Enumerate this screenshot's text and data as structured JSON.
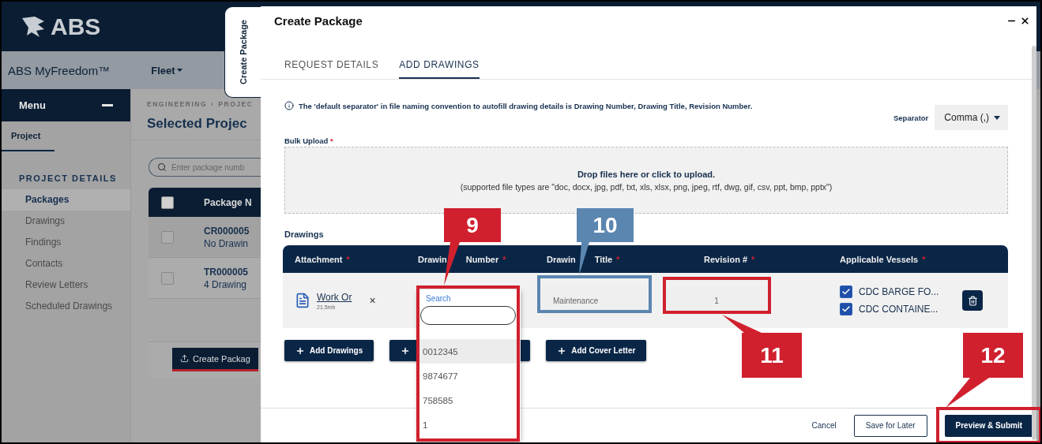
{
  "header": {
    "logo": "ABS",
    "app_name": "ABS MyFreedom™",
    "nav": [
      {
        "label": "Fleet"
      }
    ]
  },
  "sidebar": {
    "title": "Menu",
    "tabs": [
      {
        "label": "Project",
        "selected": true
      }
    ],
    "section": "PROJECT DETAILS",
    "items": [
      {
        "label": "Packages",
        "selected": true
      },
      {
        "label": "Drawings",
        "selected": false
      },
      {
        "label": "Findings",
        "selected": false
      },
      {
        "label": "Contacts",
        "selected": false
      },
      {
        "label": "Review Letters",
        "selected": false
      },
      {
        "label": "Scheduled Drawings",
        "selected": false
      }
    ]
  },
  "main": {
    "breadcrumb": {
      "items": [
        "ENGINEERING",
        "PROJEC"
      ],
      "separator": "›"
    },
    "title": "Selected Projec",
    "search": {
      "placeholder": "Enter package numb"
    },
    "table": {
      "select_all": {
        "checked": false
      },
      "columns": [
        "Package N"
      ],
      "rows": [
        {
          "selected": false,
          "title": "CR000005",
          "subtitle": "No Drawin"
        },
        {
          "selected": false,
          "title": "TR000005",
          "subtitle": "4 Drawing"
        }
      ]
    },
    "create_button": "Create Packag"
  },
  "side_tab": "Create Package",
  "drawer": {
    "title": "Create Package",
    "tabs": [
      {
        "label": "REQUEST DETAILS",
        "selected": false
      },
      {
        "label": "ADD DRAWINGS",
        "selected": true
      }
    ],
    "info": "The 'default separator' in file naming convention to autofill drawing details is Drawing Number, Drawing Title, Revision Number.",
    "separator": {
      "label": "Separator",
      "value": "Comma (,)"
    },
    "bulk_upload": {
      "label": "Bulk Upload",
      "marker": "*",
      "prompt": "Drop files here or click to upload.",
      "hint": "(supported file types are \"doc, docx, jpg, pdf, txt, xls, xlsx, png, jpeg, rtf, dwg, gif, csv, ppt, bmp, pptx\")"
    },
    "drawings": {
      "label": "Drawings",
      "columns": [
        {
          "parts": [
            "Attachment"
          ],
          "marker": "*"
        },
        {
          "parts": [
            "Drawin",
            "Number"
          ],
          "marker": "*"
        },
        {
          "parts": [
            "Drawin",
            "Title"
          ],
          "marker": "*"
        },
        {
          "parts": [
            "Revision #"
          ],
          "marker": "*"
        },
        {
          "parts": [
            "Applicable Vessels"
          ],
          "marker": "*"
        }
      ],
      "rows": [
        {
          "file": "Work Or",
          "size": "21.5mb",
          "remove": "×",
          "title": "Maintenance",
          "revision": "1",
          "vessels": [
            {
              "label": "CDC BARGE FO...",
              "checked": true
            },
            {
              "label": "CDC CONTAINE...",
              "checked": true
            }
          ]
        }
      ]
    },
    "buttons": [
      {
        "kind": "labeled",
        "label": "Add Drawings"
      },
      {
        "kind": "covered"
      },
      {
        "kind": "labeled",
        "label": "Add Cover Letter"
      }
    ],
    "footer": [
      {
        "kind": "link",
        "label": "Cancel"
      },
      {
        "kind": "outline",
        "label": "Save for Later"
      },
      {
        "kind": "primary",
        "label": "Preview & Submit"
      }
    ]
  },
  "dropdown": {
    "label": "Search",
    "options": [
      {
        "label": "0012345",
        "selected": true
      },
      {
        "label": "9874677",
        "selected": false
      },
      {
        "label": "758585",
        "selected": false
      },
      {
        "label": "1",
        "selected": false
      }
    ]
  },
  "annotations": [
    {
      "number": "9",
      "color": "#d0202e"
    },
    {
      "number": "10",
      "color": "#5b86b0"
    },
    {
      "number": "11",
      "color": "#d0202e"
    },
    {
      "number": "12",
      "color": "#d0202e"
    }
  ]
}
